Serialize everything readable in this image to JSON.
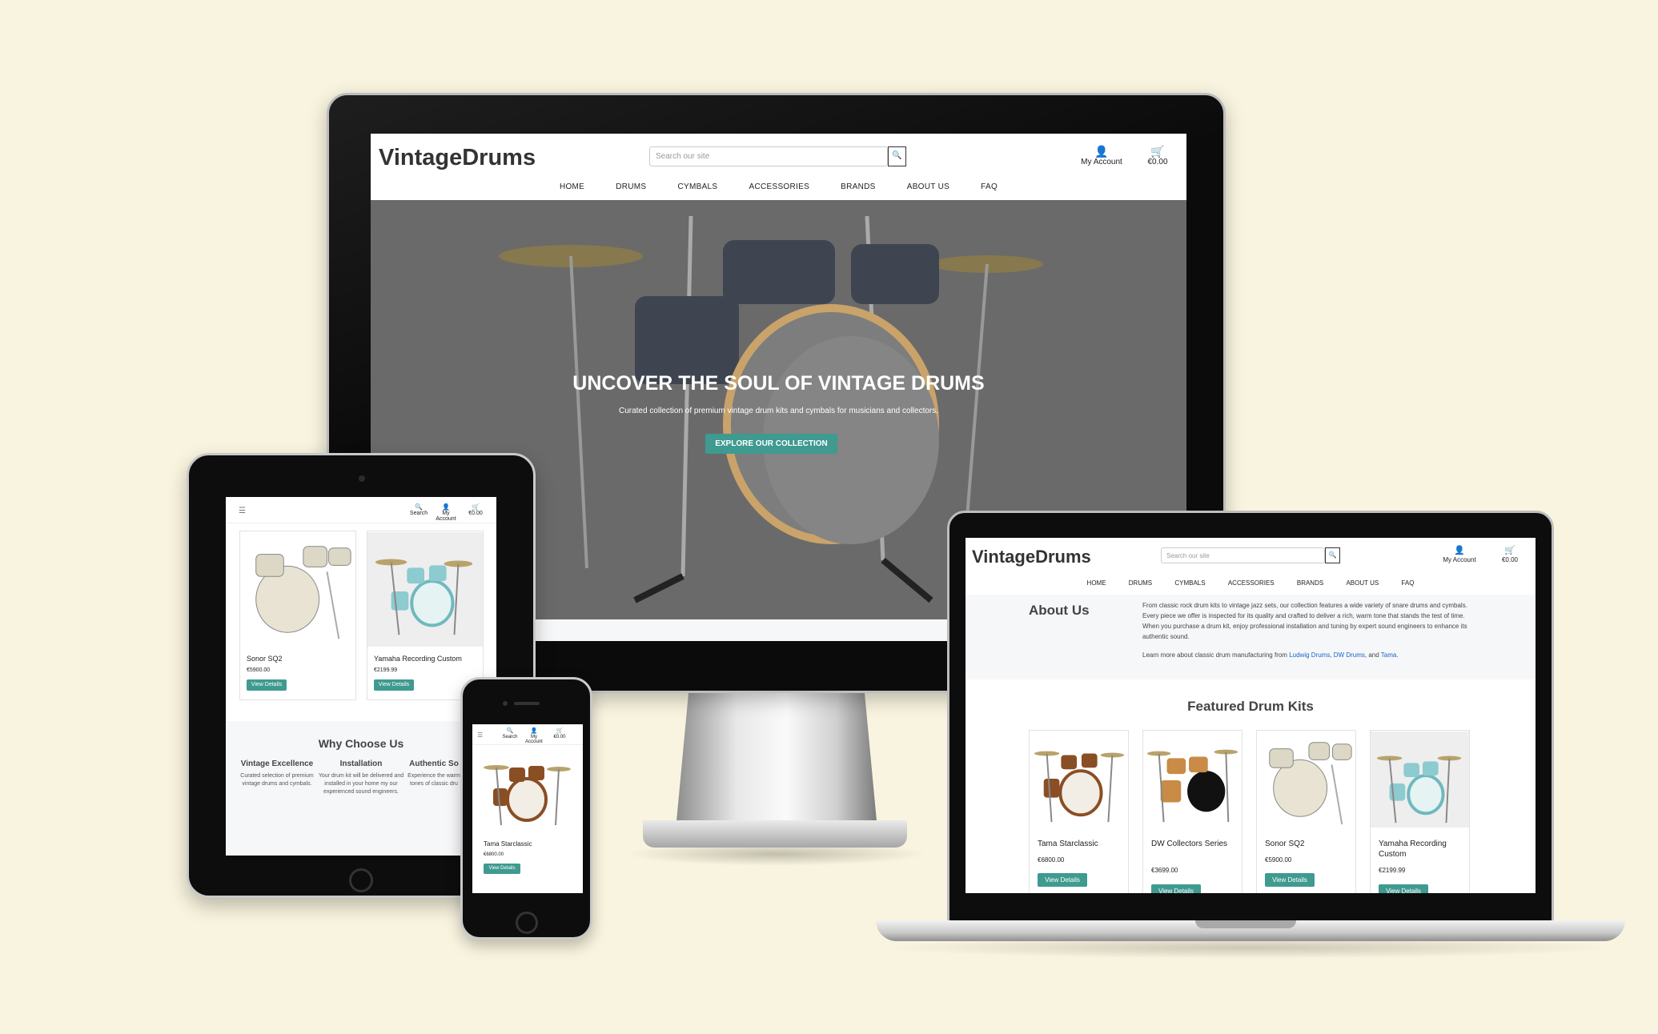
{
  "desktop": {
    "logo": "VintageDrums",
    "search_placeholder": "Search our site",
    "account_label": "My Account",
    "cart_total": "€0.00",
    "nav": [
      "HOME",
      "DRUMS",
      "CYMBALS",
      "ACCESSORIES",
      "BRANDS",
      "ABOUT US",
      "FAQ"
    ],
    "hero": {
      "title": "UNCOVER THE SOUL OF VINTAGE DRUMS",
      "subtitle": "Curated collection of premium vintage drum kits and cymbals for musicians and collectors.",
      "button": "EXPLORE OUR COLLECTION"
    }
  },
  "tablet": {
    "search_label": "Search",
    "account_label": "My Account",
    "cart_total": "€0.00",
    "products": [
      {
        "name": "Sonor SQ2",
        "price": "€5900.00",
        "button": "View Details"
      },
      {
        "name": "Yamaha Recording Custom",
        "price": "€2199.99",
        "button": "View Details"
      }
    ],
    "why": {
      "title": "Why Choose Us",
      "columns": [
        {
          "heading": "Vintage Excellence",
          "text": "Curated selection of premium vintage drums and cymbals."
        },
        {
          "heading": "Installation",
          "text": "Your drum kit will be delivered and installed in your home my our experienced sound engineers."
        },
        {
          "heading": "Authentic So",
          "text": "Experience the warm tones of classic dru"
        }
      ]
    }
  },
  "phone": {
    "search_label": "Search",
    "account_label": "My Account",
    "cart_total": "€0.00",
    "product": {
      "name": "Tama Starclassic",
      "price": "€6800.00",
      "button": "View Details"
    }
  },
  "laptop": {
    "logo": "VintageDrums",
    "search_placeholder": "Search our site",
    "account_label": "My Account",
    "cart_total": "€0.00",
    "nav": [
      "HOME",
      "DRUMS",
      "CYMBALS",
      "ACCESSORIES",
      "BRANDS",
      "ABOUT US",
      "FAQ"
    ],
    "about": {
      "title": "About Us",
      "paragraph": "From classic rock drum kits to vintage jazz sets, our collection features a wide variety of snare drums and cymbals. Every piece we offer is inspected for its quality and crafted to deliver a rich, warm tone that stands the test of time. When you purchase a drum kit, enjoy professional installation and tuning by expert sound engineers to enhance its authentic sound.",
      "learn_prefix": "Learn more about classic drum manufacturing from ",
      "links": [
        "Ludwig Drums",
        "DW Drums",
        "Tama"
      ],
      "sep1": ", ",
      "sep2": ", and ",
      "end": "."
    },
    "featured_title": "Featured Drum Kits",
    "products": [
      {
        "name": "Tama Starclassic",
        "price": "€6800.00",
        "button": "View Details"
      },
      {
        "name": "DW Collectors Series",
        "price": "€3699.00",
        "button": "View Details"
      },
      {
        "name": "Sonor SQ2",
        "price": "€5900.00",
        "button": "View Details"
      },
      {
        "name": "Yamaha Recording Custom",
        "price": "€2199.99",
        "button": "View Details"
      }
    ]
  },
  "colors": {
    "background": "#f9f4df",
    "accent": "#3f9a90",
    "link": "#1a63c9"
  },
  "icons": [
    "search-icon",
    "user-icon",
    "cart-icon",
    "hamburger-icon"
  ]
}
